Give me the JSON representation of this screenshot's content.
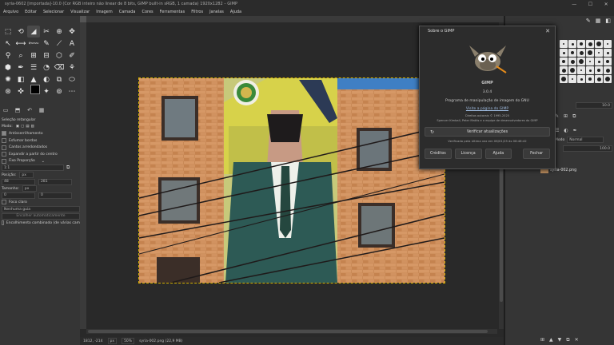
{
  "window": {
    "title": "syria-0602 [importada]-10.0 (Cor RGB inteiro não linear de 8 bits, GIMP built-in sRGB, 1 camada) 1920x1282 – GIMP",
    "minimize": "—",
    "maximize": "☐",
    "close": "✕"
  },
  "menubar": [
    "Arquivo",
    "Editar",
    "Selecionar",
    "Visualizar",
    "Imagem",
    "Camada",
    "Cores",
    "Ferramentas",
    "Filtros",
    "Janelas",
    "Ajuda"
  ],
  "toolbox": {
    "tools": [
      "⬚",
      "⟲",
      "◢",
      "✂",
      "⊕",
      "✥",
      "↖",
      "⟷",
      "⬳",
      "✎",
      "⟋",
      "A",
      "⚲",
      "⌕",
      "⊞",
      "⊟",
      "⬡",
      "✐",
      "⬢",
      "✒",
      "☰",
      "◔",
      "⌫",
      "⚘",
      "✺",
      "◧",
      "▲",
      "◐",
      "⧉",
      "⬭",
      "⊛",
      "✜",
      "✚",
      "✦",
      "⊚",
      "⋯"
    ],
    "options_title": "Seleção retangular",
    "mode_label": "Modo:",
    "antialias": "Antisserrilhamento",
    "feather": "Esfumar bordas",
    "rounded": "Cantos arredondados",
    "expand_center": "Expandir a partir do centro",
    "fixed": "Fixo Proporção",
    "ratio": "1:1",
    "position_label": "Posição:",
    "position_unit": "px",
    "pos_x": "48",
    "pos_y": "281",
    "size_label": "Tamanho:",
    "size_unit": "px",
    "size_w": "0",
    "size_h": "0",
    "highlight": "Foco claro",
    "guides": "Nenhuma guia",
    "auto_shrink": "Encolher automaticamente",
    "combined": "Encolhimento combinado (de várias cam"
  },
  "status": {
    "coords": "1812, -214",
    "unit": "px",
    "zoom": "50%",
    "file": "syria-002.png (22,9 MB)"
  },
  "right_panel": {
    "spacing_value": "10.0",
    "mode_label": "Modo",
    "mode_value": "Normal",
    "opacity_value": "100.0",
    "layer_name": "syria-002.png"
  },
  "about_dialog": {
    "title": "Sobre o GIMP",
    "app_name": "GIMP",
    "version": "3.0.4",
    "description": "Programa de manipulação de imagem do GNU",
    "link": "Visite a página do GIMP",
    "copyright": "Direitos autorais © 1995-2025",
    "credits_line": "Spencer Kimball, Peter Mattis e a equipe de desenvolvedores do GIMP",
    "update_button": "Verificar atualizações",
    "last_checked": "Verificado pela última vez em 06/01/25 às 08:46:42",
    "buttons": [
      "Créditos",
      "Licença",
      "Ajuda",
      "Fechar"
    ]
  }
}
